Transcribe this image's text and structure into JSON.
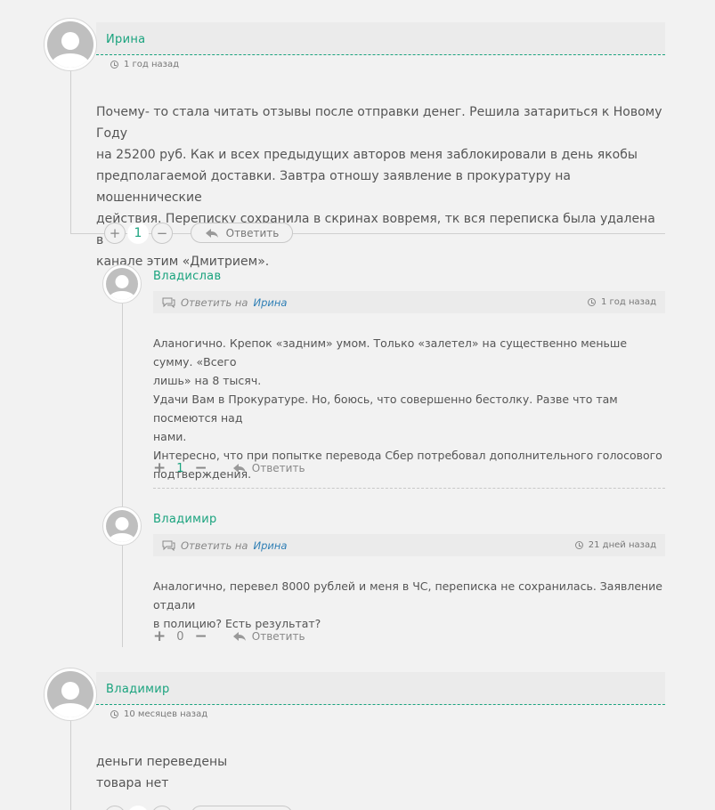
{
  "comments": [
    {
      "author": "Ирина",
      "time": "1 год назад",
      "text": [
        "Почему- то стала читать отзывы после отправки денег. Решила затариться к Новому Году",
        "на 25200 руб. Как и всех предыдущих авторов меня заблокировали в день якобы",
        "предполагаемой доставки. Завтра отношу заявление в прокуратуру на мошеннические",
        "действия. Переписку сохранила в скринах вовремя, тк вся переписка была удалена в",
        "канале этим «Дмитрием»."
      ],
      "votes": "1",
      "reply_label": "Ответить",
      "replies": [
        {
          "author": "Владислав",
          "reply_to_label": "Ответить на",
          "reply_to_name": "Ирина",
          "time": "1 год назад",
          "text": [
            "Аланогично. Крепок «задним» умом. Только «залетел» на существенно меньше сумму. «Всего",
            "лишь» на 8 тысяч.",
            "Удачи Вам в Прокуратуре. Но, боюсь, что совершенно бестолку. Разве что там посмеются над",
            "нами.",
            "Интересно, что при попытке перевода Сбер потребовал дополнительного голосового",
            "подтверждения."
          ],
          "votes": "1",
          "reply_label": "Ответить"
        },
        {
          "author": "Владимир",
          "reply_to_label": "Ответить на",
          "reply_to_name": "Ирина",
          "time": "21 дней назад",
          "text": [
            "Аналогично, перевел 8000 рублей и меня в ЧС, переписка не сохранилась. Заявление отдали",
            "в полицию? Есть результат?"
          ],
          "votes": "0",
          "reply_label": "Ответить"
        }
      ]
    },
    {
      "author": "Владимир",
      "time": "10 месяцев назад",
      "text": [
        "деньги переведены",
        "товара нет"
      ]
    }
  ],
  "icons": {
    "plus": "+",
    "minus": "−",
    "reply": "reply-arrow-icon",
    "clock": "clock-icon",
    "bubble": "speech-bubble-icon"
  },
  "colors": {
    "accent": "#1aa37e",
    "link": "#2f7fb5",
    "background": "#f2f2f2"
  }
}
